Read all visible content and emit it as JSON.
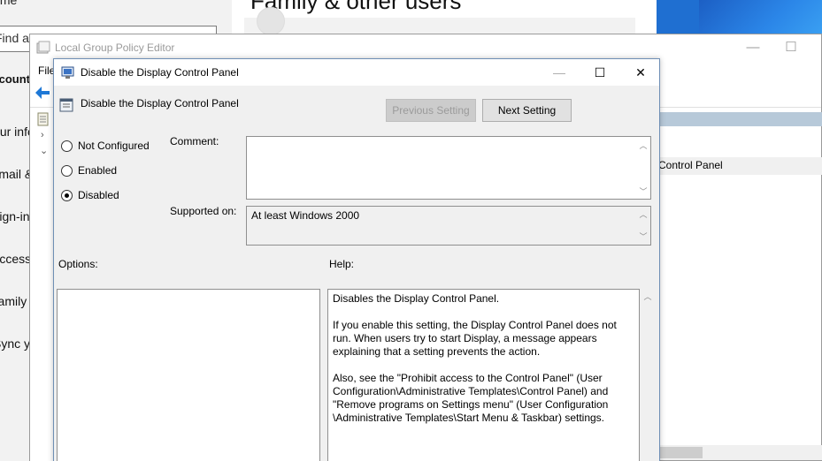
{
  "settings": {
    "home_label": "Home",
    "search_placeholder": "Find a setting",
    "section": "Accounts",
    "nav_items": [
      "Your info",
      "Email & accounts",
      "Sign-in options",
      "Access work or school",
      "Family & other users",
      "Sync your settings"
    ],
    "page_title": "Family & other users"
  },
  "gpe": {
    "title": "Local Group Policy Editor",
    "menu_file": "File",
    "list_item": "Control Panel"
  },
  "dialog": {
    "title": "Disable the Display Control Panel",
    "policy_name": "Disable the Display Control Panel",
    "prev_button": "Previous Setting",
    "next_button": "Next Setting",
    "radio_not_configured": "Not Configured",
    "radio_enabled": "Enabled",
    "radio_disabled": "Disabled",
    "selected_state": "Disabled",
    "comment_label": "Comment:",
    "comment_value": "",
    "supported_label": "Supported on:",
    "supported_value": "At least Windows 2000",
    "options_label": "Options:",
    "help_label": "Help:",
    "help_p1": "Disables the Display Control Panel.",
    "help_p2": "If you enable this setting, the Display Control Panel does not run. When users try to start Display, a message appears explaining that a setting prevents the action.",
    "help_p3": "Also, see the \"Prohibit access to the Control Panel\" (User Configuration\\Administrative Templates\\Control Panel) and \"Remove programs on Settings menu\" (User Configuration \\Administrative Templates\\Start Menu & Taskbar) settings."
  },
  "colors": {
    "desktop_blue": "#1f6fd1",
    "dialog_bg": "#f0f0f0",
    "header_strip": "#b7c9d9"
  }
}
